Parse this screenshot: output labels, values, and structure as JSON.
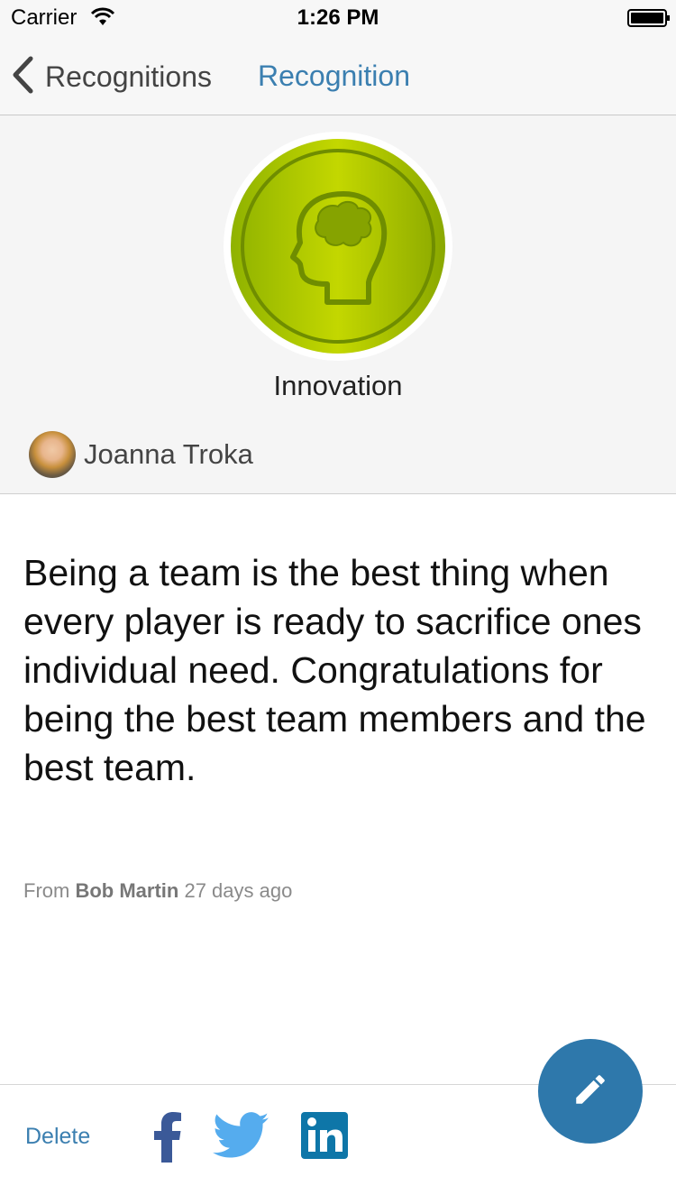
{
  "status_bar": {
    "carrier": "Carrier",
    "time": "1:26 PM",
    "wifi_icon": "wifi-icon",
    "battery_icon": "battery-full-icon"
  },
  "nav": {
    "back_label": "Recognitions",
    "back_icon": "chevron-left-icon",
    "title": "Recognition"
  },
  "badge": {
    "name": "Innovation",
    "icon": "brain-head-icon",
    "color": "#a8c400"
  },
  "recipient": {
    "name": "Joanna Troka"
  },
  "message": "Being a team is the best thing when every player is ready to sacrifice ones individual need. Congratulations for being the best team members and the best team.",
  "meta": {
    "from_prefix": "From",
    "from_name": "Bob Martin",
    "time_ago": "27 days ago"
  },
  "actions": {
    "delete_label": "Delete",
    "share": [
      "facebook-icon",
      "twitter-icon",
      "linkedin-icon"
    ],
    "edit_icon": "pencil-icon"
  },
  "colors": {
    "accent": "#3b7fb0",
    "fab": "#2e78ab",
    "facebook": "#3b5998",
    "twitter": "#55acee",
    "linkedin": "#0e76a8"
  }
}
